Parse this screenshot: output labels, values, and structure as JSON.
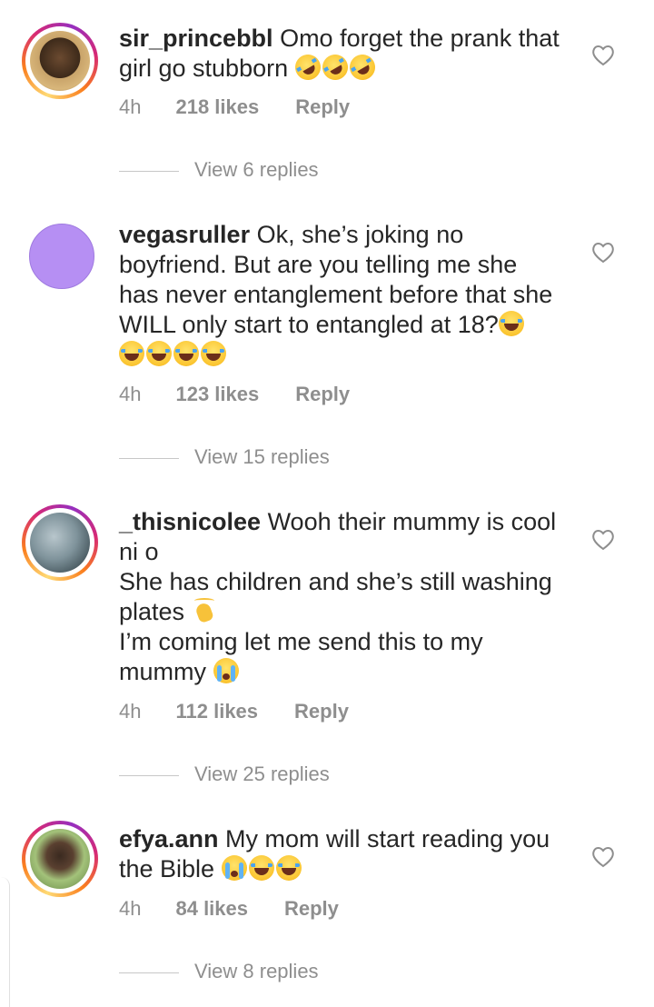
{
  "comments": [
    {
      "username": "sir_princebbl",
      "text_line1": " Omo forget the prank that",
      "text_line2": "girl go stubborn ",
      "emoji": [
        "rolling-on-floor-laughing",
        "rolling-on-floor-laughing",
        "rolling-on-floor-laughing"
      ],
      "time": "4h",
      "likes": "218 likes",
      "reply_label": "Reply",
      "view_replies": "View 6 replies",
      "has_story_ring": true
    },
    {
      "username": "vegasruller",
      "text_line1": " Ok, she’s joking no",
      "text_line2": "boyfriend. But are you telling me she",
      "text_line3": "has never entanglement before that she",
      "text_line4": "WILL only start to entangled at 18?",
      "emoji": [
        "face-with-tears-of-joy",
        "face-with-tears-of-joy",
        "face-with-tears-of-joy",
        "face-with-tears-of-joy",
        "face-with-tears-of-joy"
      ],
      "time": "4h",
      "likes": "123 likes",
      "reply_label": "Reply",
      "view_replies": "View 15 replies",
      "has_story_ring": false,
      "avatar_color": "#b68ff3"
    },
    {
      "username": "_thisnicolee",
      "text_line1": " Wooh their mummy is cool",
      "text_line2": "ni o",
      "text_line3": "She has children and she’s still washing",
      "text_line4": "plates ",
      "text_line5": "I’m coming let me send this to my",
      "text_line6": "mummy ",
      "emoji": [
        "clapping-hands",
        "tired-face"
      ],
      "time": "4h",
      "likes": "112 likes",
      "reply_label": "Reply",
      "view_replies": "View 25 replies",
      "has_story_ring": true
    },
    {
      "username": "efya.ann",
      "text_line1": " My mom will start reading you",
      "text_line2": "the Bible ",
      "emoji": [
        "loudly-crying-face",
        "face-with-tears-of-joy",
        "face-with-tears-of-joy"
      ],
      "time": "4h",
      "likes": "84 likes",
      "reply_label": "Reply",
      "view_replies": "View 8 replies",
      "has_story_ring": true
    }
  ],
  "colors": {
    "text": "#262626",
    "secondary": "#8e8e8e",
    "divider": "#c7c7c7",
    "story_ring_start": "#feda75",
    "story_ring_end": "#d62976"
  },
  "icons": {
    "like": "heart-outline-icon"
  }
}
